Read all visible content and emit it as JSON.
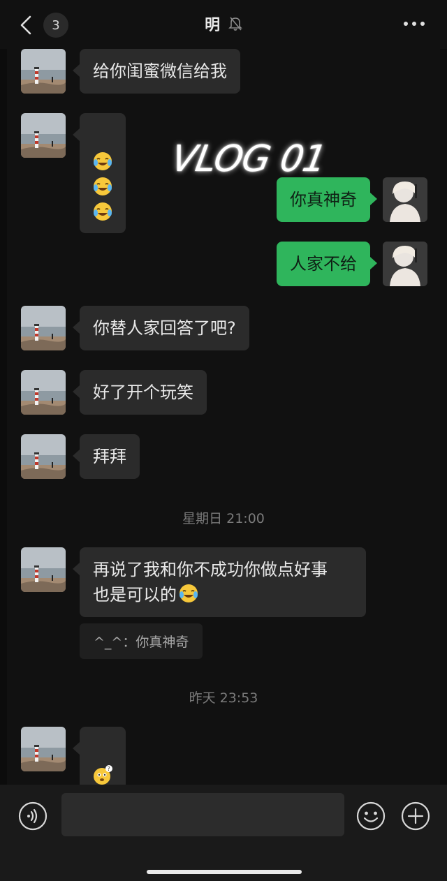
{
  "header": {
    "back_icon": "chevron-left-icon",
    "unread_count": "3",
    "title": "明",
    "mute_icon": "bell-off-icon",
    "more_icon": "more-horizontal-icon"
  },
  "overlay": {
    "text": "VLOG 01"
  },
  "messages": [
    {
      "side": "in",
      "text": "给你闺蜜微信给我"
    },
    {
      "side": "in",
      "emoji": [
        "laugh-cry-emoji",
        "laugh-cry-emoji",
        "laugh-cry-emoji"
      ]
    },
    {
      "side": "out",
      "text": "你真神奇"
    },
    {
      "side": "out",
      "text": "人家不给"
    },
    {
      "side": "in",
      "text": "你替人家回答了吧?"
    },
    {
      "side": "in",
      "text": "好了开个玩笑"
    },
    {
      "side": "in",
      "text": "拜拜"
    },
    {
      "timestamp": "星期日 21:00"
    },
    {
      "side": "in",
      "text": "再说了我和你不成功你做点好事\n也是可以的",
      "trailing_emoji": "laugh-cry-emoji"
    },
    {
      "quote": "^_^：你真神奇"
    },
    {
      "timestamp": "昨天 23:53"
    },
    {
      "side": "in",
      "emoji": [
        "confused-emoji"
      ]
    }
  ],
  "input_bar": {
    "voice_icon": "voice-icon",
    "emoji_icon": "smiley-icon",
    "plus_icon": "plus-circle-icon",
    "text_value": ""
  },
  "colors": {
    "background": "#111111",
    "incoming_bubble": "#2b2b2b",
    "outgoing_bubble": "#2fb55c",
    "timestamp": "#7b7b7b"
  }
}
